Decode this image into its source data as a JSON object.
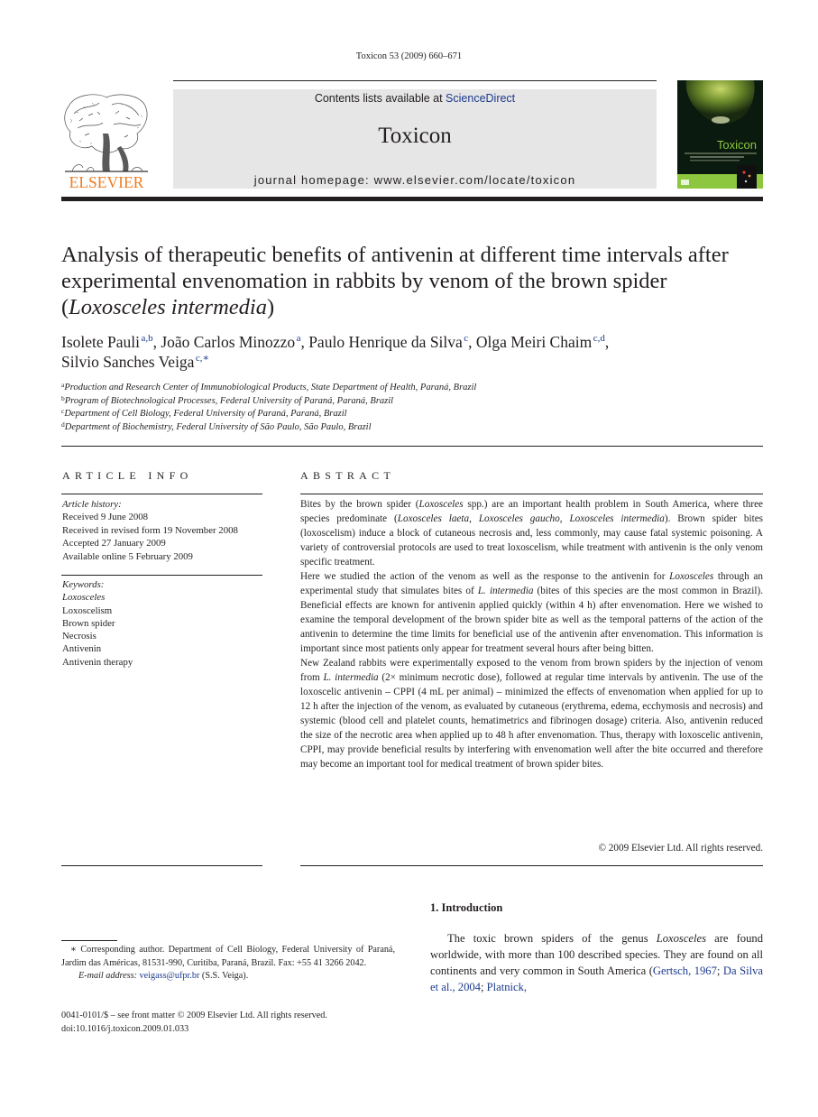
{
  "running_head": "Toxicon 53 (2009) 660–671",
  "header": {
    "publisher_logo_text": "ELSEVIER",
    "contents_prefix": "Contents lists available at ",
    "contents_link": "ScienceDirect",
    "journal_title": "Toxicon",
    "homepage": "journal homepage: www.elsevier.com/locate/toxicon",
    "cover_title": "Toxicon",
    "colors": {
      "elsevier_orange": "#f07c1e",
      "link_blue": "#1b3a8c",
      "cover_green": "#8dc63f"
    }
  },
  "article": {
    "title_part1": "Analysis of therapeutic benefits of antivenin at different time intervals after experimental envenomation in rabbits by venom of the brown spider (",
    "title_italic": "Loxosceles intermedia",
    "title_part2": ")",
    "authors": [
      {
        "name": "Isolete Pauli",
        "aff": "a,b",
        "sep": ", "
      },
      {
        "name": "João Carlos Minozzo",
        "aff": "a",
        "sep": ", "
      },
      {
        "name": "Paulo Henrique da Silva",
        "aff": "c",
        "sep": ", "
      },
      {
        "name": "Olga Meiri Chaim",
        "aff": "c,d",
        "sep": ", "
      },
      {
        "name": "Silvio Sanches Veiga",
        "aff": "c,∗",
        "sep": ""
      }
    ],
    "affiliations": [
      {
        "key": "a",
        "text": "Production and Research Center of Immunobiological Products, State Department of Health, Paraná, Brazil"
      },
      {
        "key": "b",
        "text": "Program of Biotechnological Processes, Federal University of Paraná, Paraná, Brazil"
      },
      {
        "key": "c",
        "text": "Department of Cell Biology, Federal University of Paraná, Paraná, Brazil"
      },
      {
        "key": "d",
        "text": "Department of Biochemistry, Federal University of São Paulo, São Paulo, Brazil"
      }
    ]
  },
  "article_info": {
    "heading": "ARTICLE INFO",
    "history_label": "Article history:",
    "history": [
      "Received 9 June 2008",
      "Received in revised form 19 November 2008",
      "Accepted 27 January 2009",
      "Available online 5 February 2009"
    ],
    "keywords_label": "Keywords:",
    "keywords": [
      "Loxosceles",
      "Loxoscelism",
      "Brown spider",
      "Necrosis",
      "Antivenin",
      "Antivenin therapy"
    ]
  },
  "abstract": {
    "heading": "ABSTRACT",
    "p1": [
      {
        "t": "Bites by the brown spider ("
      },
      {
        "i": "Loxosceles"
      },
      {
        "t": " spp.) are an important health problem in South America, where three species predominate ("
      },
      {
        "i": "Loxosceles laeta"
      },
      {
        "t": ", "
      },
      {
        "i": "Loxosceles gaucho"
      },
      {
        "t": ", "
      },
      {
        "i": "Loxosceles intermedia"
      },
      {
        "t": "). Brown spider bites (loxoscelism) induce a block of cutaneous necrosis and, less commonly, may cause fatal systemic poisoning. A variety of controversial protocols are used to treat loxoscelism, while treatment with antivenin is the only venom specific treatment."
      }
    ],
    "p2": [
      {
        "t": "Here we studied the action of the venom as well as the response to the antivenin for "
      },
      {
        "i": "Loxosceles"
      },
      {
        "t": " through an experimental study that simulates bites of "
      },
      {
        "i": "L. intermedia"
      },
      {
        "t": " (bites of this species are the most common in Brazil). Beneficial effects are known for antivenin applied quickly (within 4 h) after envenomation. Here we wished to examine the temporal development of the brown spider bite as well as the temporal patterns of the action of the antivenin to determine the time limits for beneficial use of the antivenin after envenomation. This information is important since most patients only appear for treatment several hours after being bitten."
      }
    ],
    "p3": [
      {
        "t": "New Zealand rabbits were experimentally exposed to the venom from brown spiders by the injection of venom from "
      },
      {
        "i": "L. intermedia"
      },
      {
        "t": " (2× minimum necrotic dose), followed at regular time intervals by antivenin. The use of the loxoscelic antivenin – CPPI (4 mL per animal) – minimized the effects of envenomation when applied for up to 12 h after the injection of the venom, as evaluated by cutaneous (erythrema, edema, ecchymosis and necrosis) and systemic (blood cell and platelet counts, hematimetrics and fibrinogen dosage) criteria. Also, antivenin reduced the size of the necrotic area when applied up to 48 h after envenomation. Thus, therapy with loxoscelic antivenin, CPPI, may provide beneficial results by interfering with envenomation well after the bite occurred and therefore may become an important tool for medical treatment of brown spider bites."
      }
    ],
    "copyright": "© 2009 Elsevier Ltd. All rights reserved."
  },
  "footnote": {
    "corresponding": "∗  Corresponding author. Department of Cell Biology, Federal University of Paraná, Jardim das Américas, 81531-990, Curitiba, Paraná, Brazil. Fax: +55 41 3266 2042.",
    "email_label": "E-mail address:",
    "email": "veigass@ufpr.br",
    "email_suffix": " (S.S. Veiga).",
    "front_matter": "0041-0101/$ – see front matter © 2009 Elsevier Ltd. All rights reserved.",
    "doi": "doi:10.1016/j.toxicon.2009.01.033"
  },
  "introduction": {
    "heading": "1.  Introduction",
    "body": [
      {
        "t": "The toxic brown spiders of the genus "
      },
      {
        "i": "Loxosceles"
      },
      {
        "t": " are found worldwide, with more than 100 described species. They are found on all continents and very common in South America ("
      },
      {
        "l": "Gertsch, 1967"
      },
      {
        "t": "; "
      },
      {
        "l": "Da Silva et al., 2004"
      },
      {
        "t": "; "
      },
      {
        "l": "Platnick,"
      }
    ]
  }
}
